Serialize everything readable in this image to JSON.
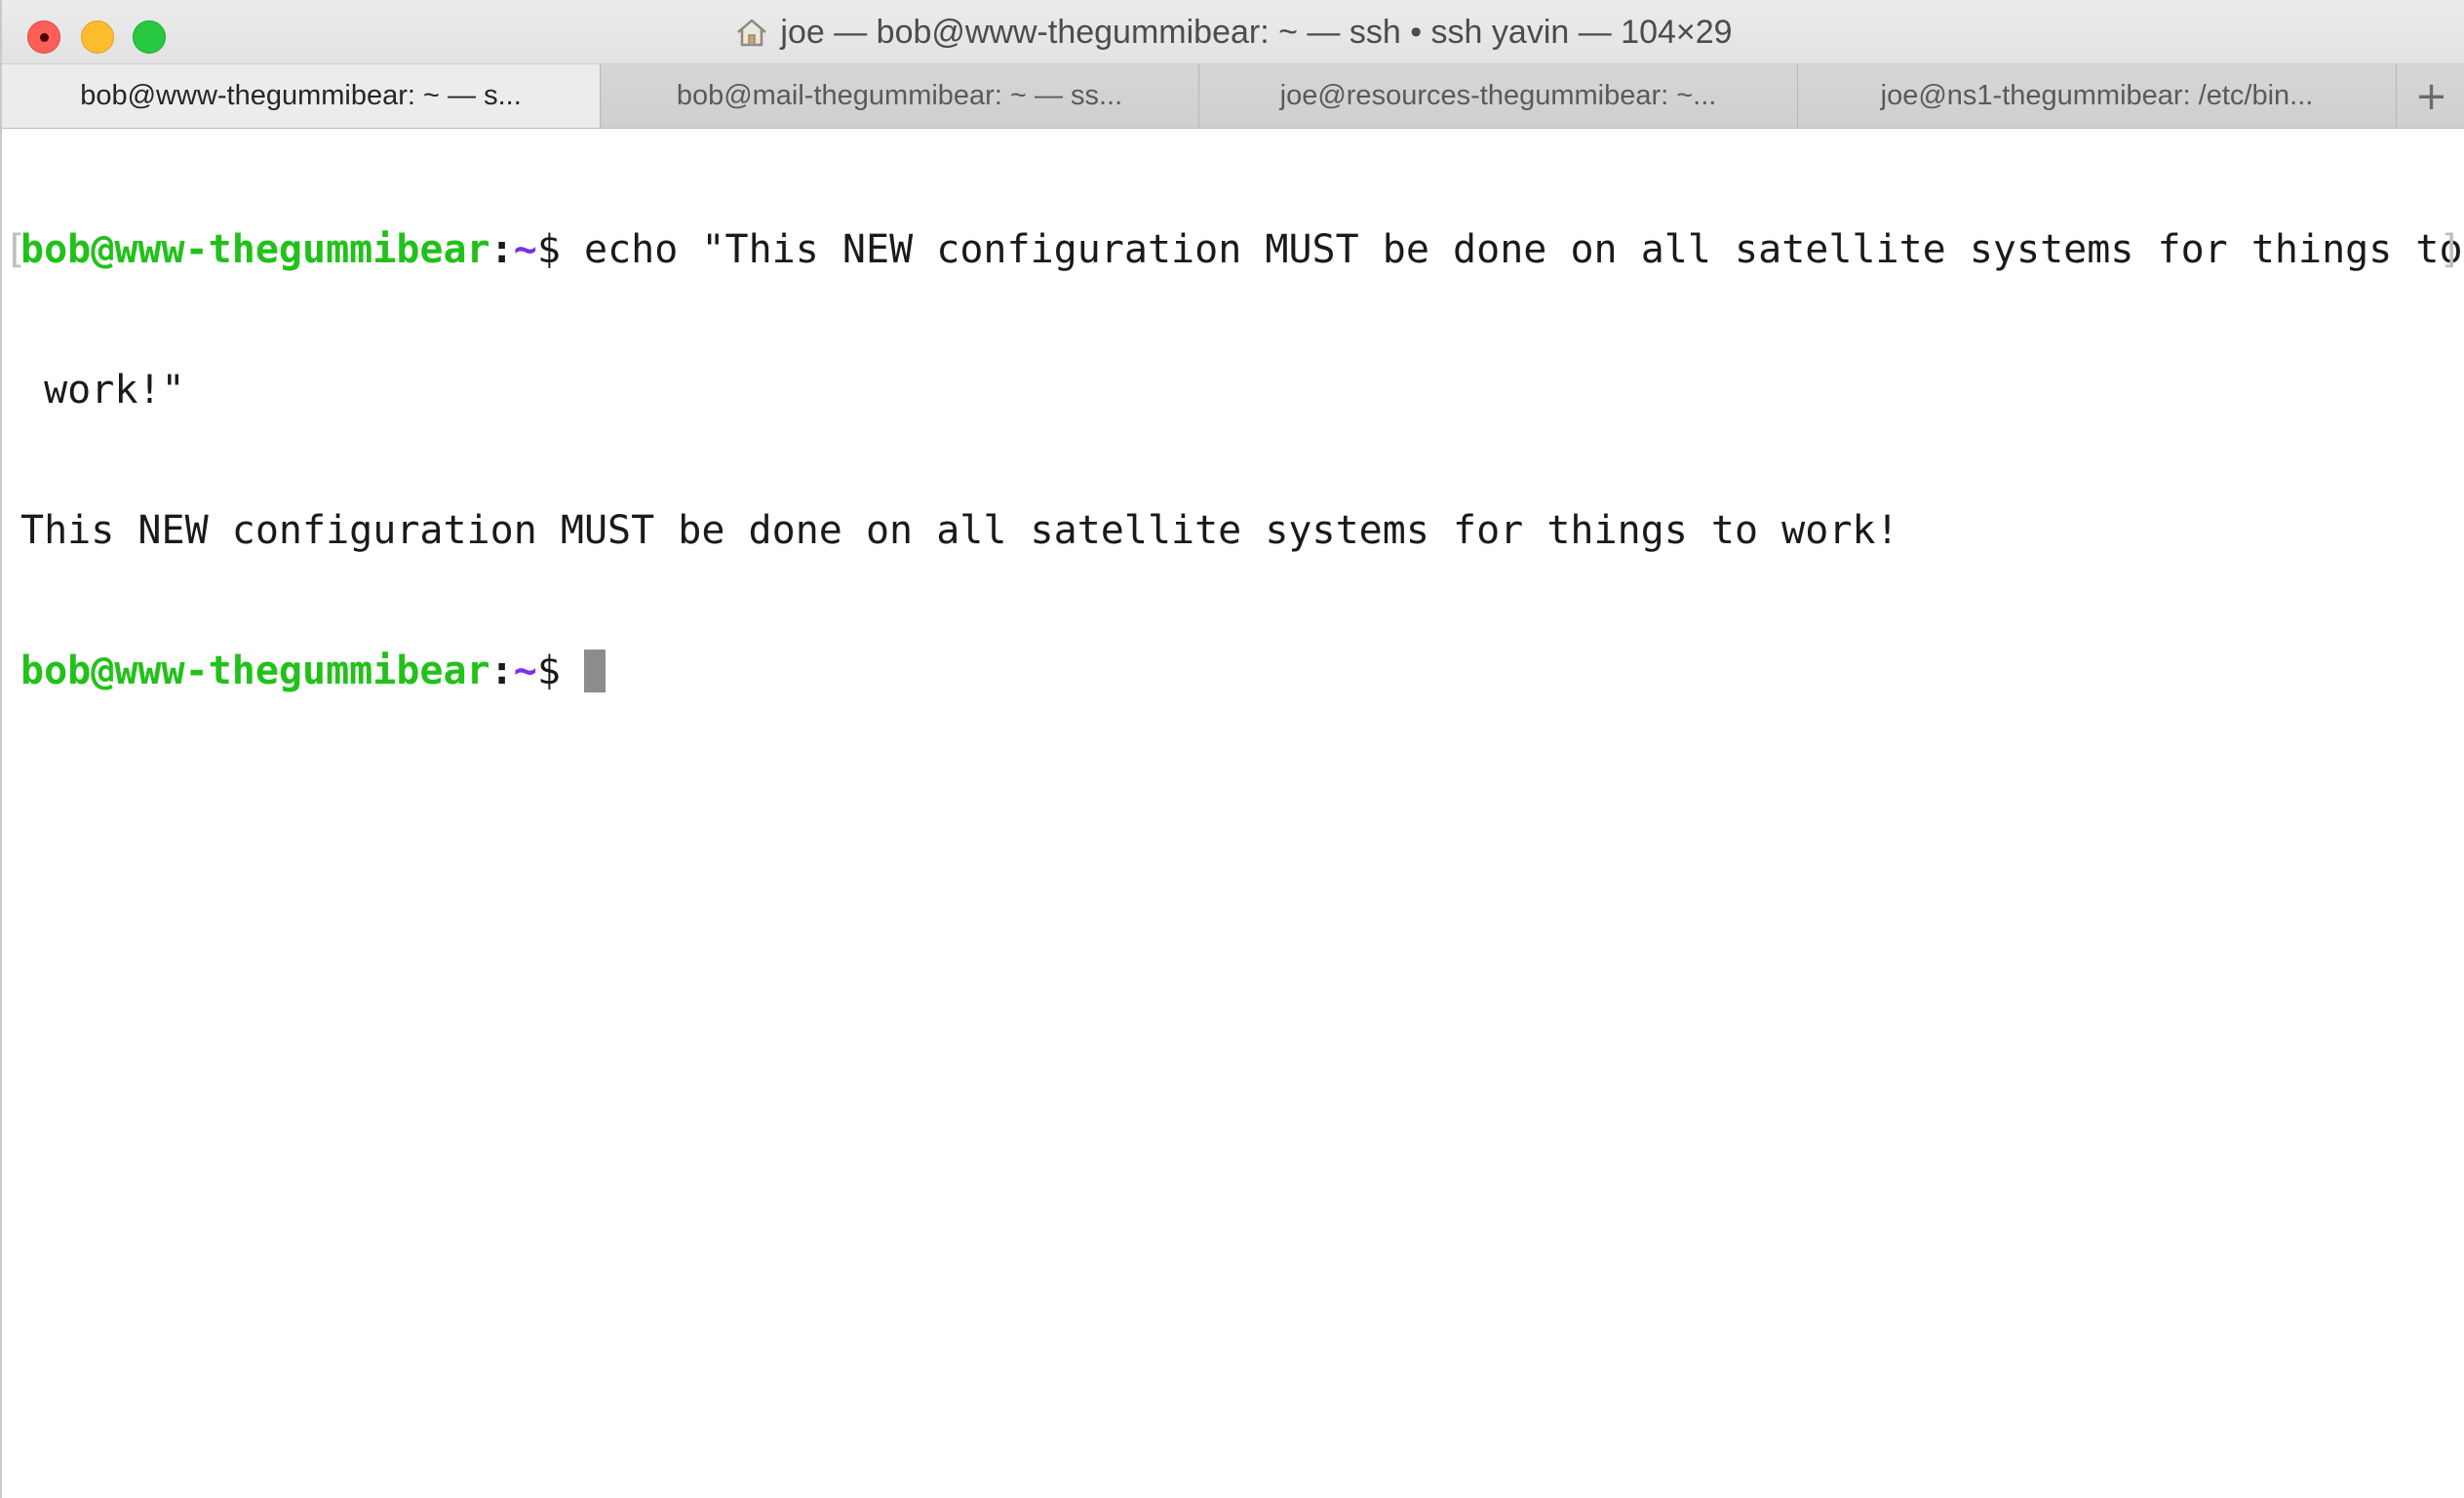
{
  "window": {
    "title": "joe — bob@www-thegummibear: ~ — ssh • ssh yavin — 104×29"
  },
  "tabs": [
    {
      "label": "bob@www-thegummibear: ~ — s...",
      "active": true
    },
    {
      "label": "bob@mail-thegummibear: ~ — ss...",
      "active": false
    },
    {
      "label": "joe@resources-thegummibear: ~...",
      "active": false
    },
    {
      "label": "joe@ns1-thegummibear: /etc/bin...",
      "active": false
    }
  ],
  "new_tab_label": "+",
  "terminal": {
    "prompt_user_host": "bob@www-thegummibear",
    "prompt_colon": ":",
    "prompt_path": "~",
    "prompt_dollar": "$",
    "command_line_1": " echo \"This NEW configuration MUST be done on all satellite systems for things to",
    "command_line_2": " work!\"",
    "output_line": "This NEW configuration MUST be done on all satellite systems for things to work!"
  },
  "colors": {
    "prompt_user_host": "#22c11a",
    "prompt_path": "#7a31e6",
    "close": "#fc5f57",
    "minimize": "#fdbc2e",
    "zoom": "#28c840"
  },
  "icons": {
    "title_icon": "home-icon",
    "new_tab": "plus-icon"
  }
}
